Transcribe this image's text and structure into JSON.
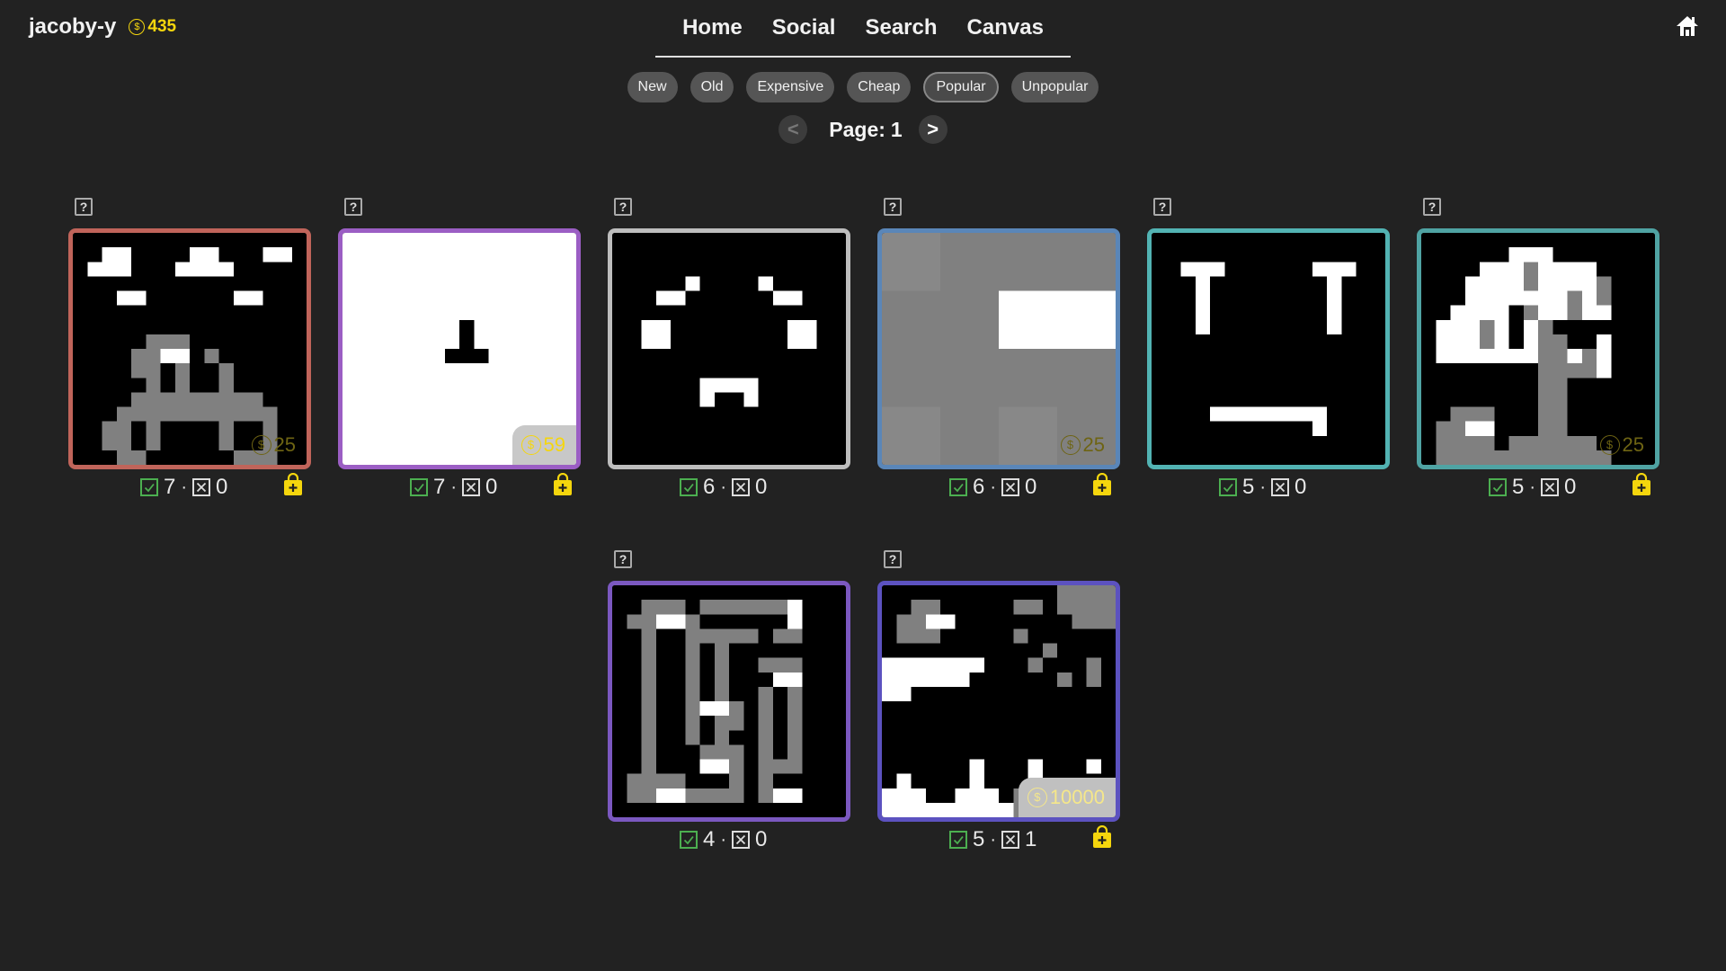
{
  "user": {
    "name": "jacoby-y",
    "coins": "435",
    "coin_symbol": "$"
  },
  "nav": [
    "Home",
    "Social",
    "Search",
    "Canvas"
  ],
  "sorts": [
    "New",
    "Old",
    "Expensive",
    "Cheap",
    "Popular",
    "Unpopular"
  ],
  "active_sort": "Popular",
  "pager": {
    "prev": "<",
    "label": "Page:",
    "page": "1",
    "next": ">"
  },
  "help_text": "?",
  "vote_sep": "·",
  "colors": {
    "accent": "#f5d60d",
    "upvote": "#4caf50",
    "background": "#222222"
  },
  "artworks": [
    {
      "up": "7",
      "down": "0",
      "price": "25",
      "border": "#c0645a",
      "buy": true
    },
    {
      "up": "7",
      "down": "0",
      "price": "59",
      "border": "#9b5ec4",
      "buy": true
    },
    {
      "up": "6",
      "down": "0",
      "price": "",
      "border": "#bdbdbd",
      "buy": false
    },
    {
      "up": "6",
      "down": "0",
      "price": "25",
      "border": "#5a86b8",
      "buy": true
    },
    {
      "up": "5",
      "down": "0",
      "price": "",
      "border": "#52b3b3",
      "buy": false
    },
    {
      "up": "5",
      "down": "0",
      "price": "25",
      "border": "#4fa3a3",
      "buy": true
    },
    {
      "up": "4",
      "down": "0",
      "price": "",
      "border": "#7b58c0",
      "buy": false
    },
    {
      "up": "5",
      "down": "1",
      "price": "10000",
      "border": "#5c52c0",
      "buy": true
    }
  ]
}
